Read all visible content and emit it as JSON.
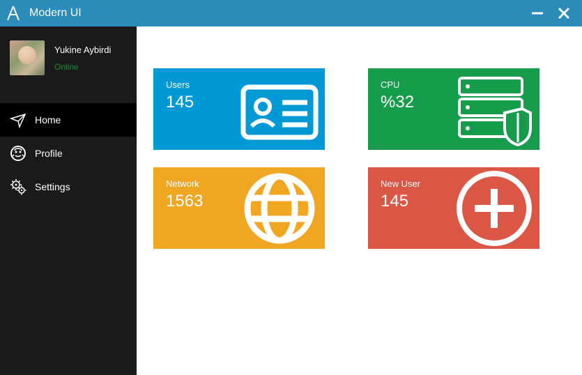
{
  "titlebar": {
    "title": "Modern UI"
  },
  "profile": {
    "name": "Yukine Aybirdi",
    "status": "Online"
  },
  "nav": {
    "items": [
      {
        "label": "Home"
      },
      {
        "label": "Profile"
      },
      {
        "label": "Settings"
      }
    ]
  },
  "cards": {
    "users": {
      "label": "Users",
      "value": "145"
    },
    "cpu": {
      "label": "CPU",
      "value": "%32"
    },
    "network": {
      "label": "Network",
      "value": "1563"
    },
    "newuser": {
      "label": "New User",
      "value": "145"
    }
  }
}
